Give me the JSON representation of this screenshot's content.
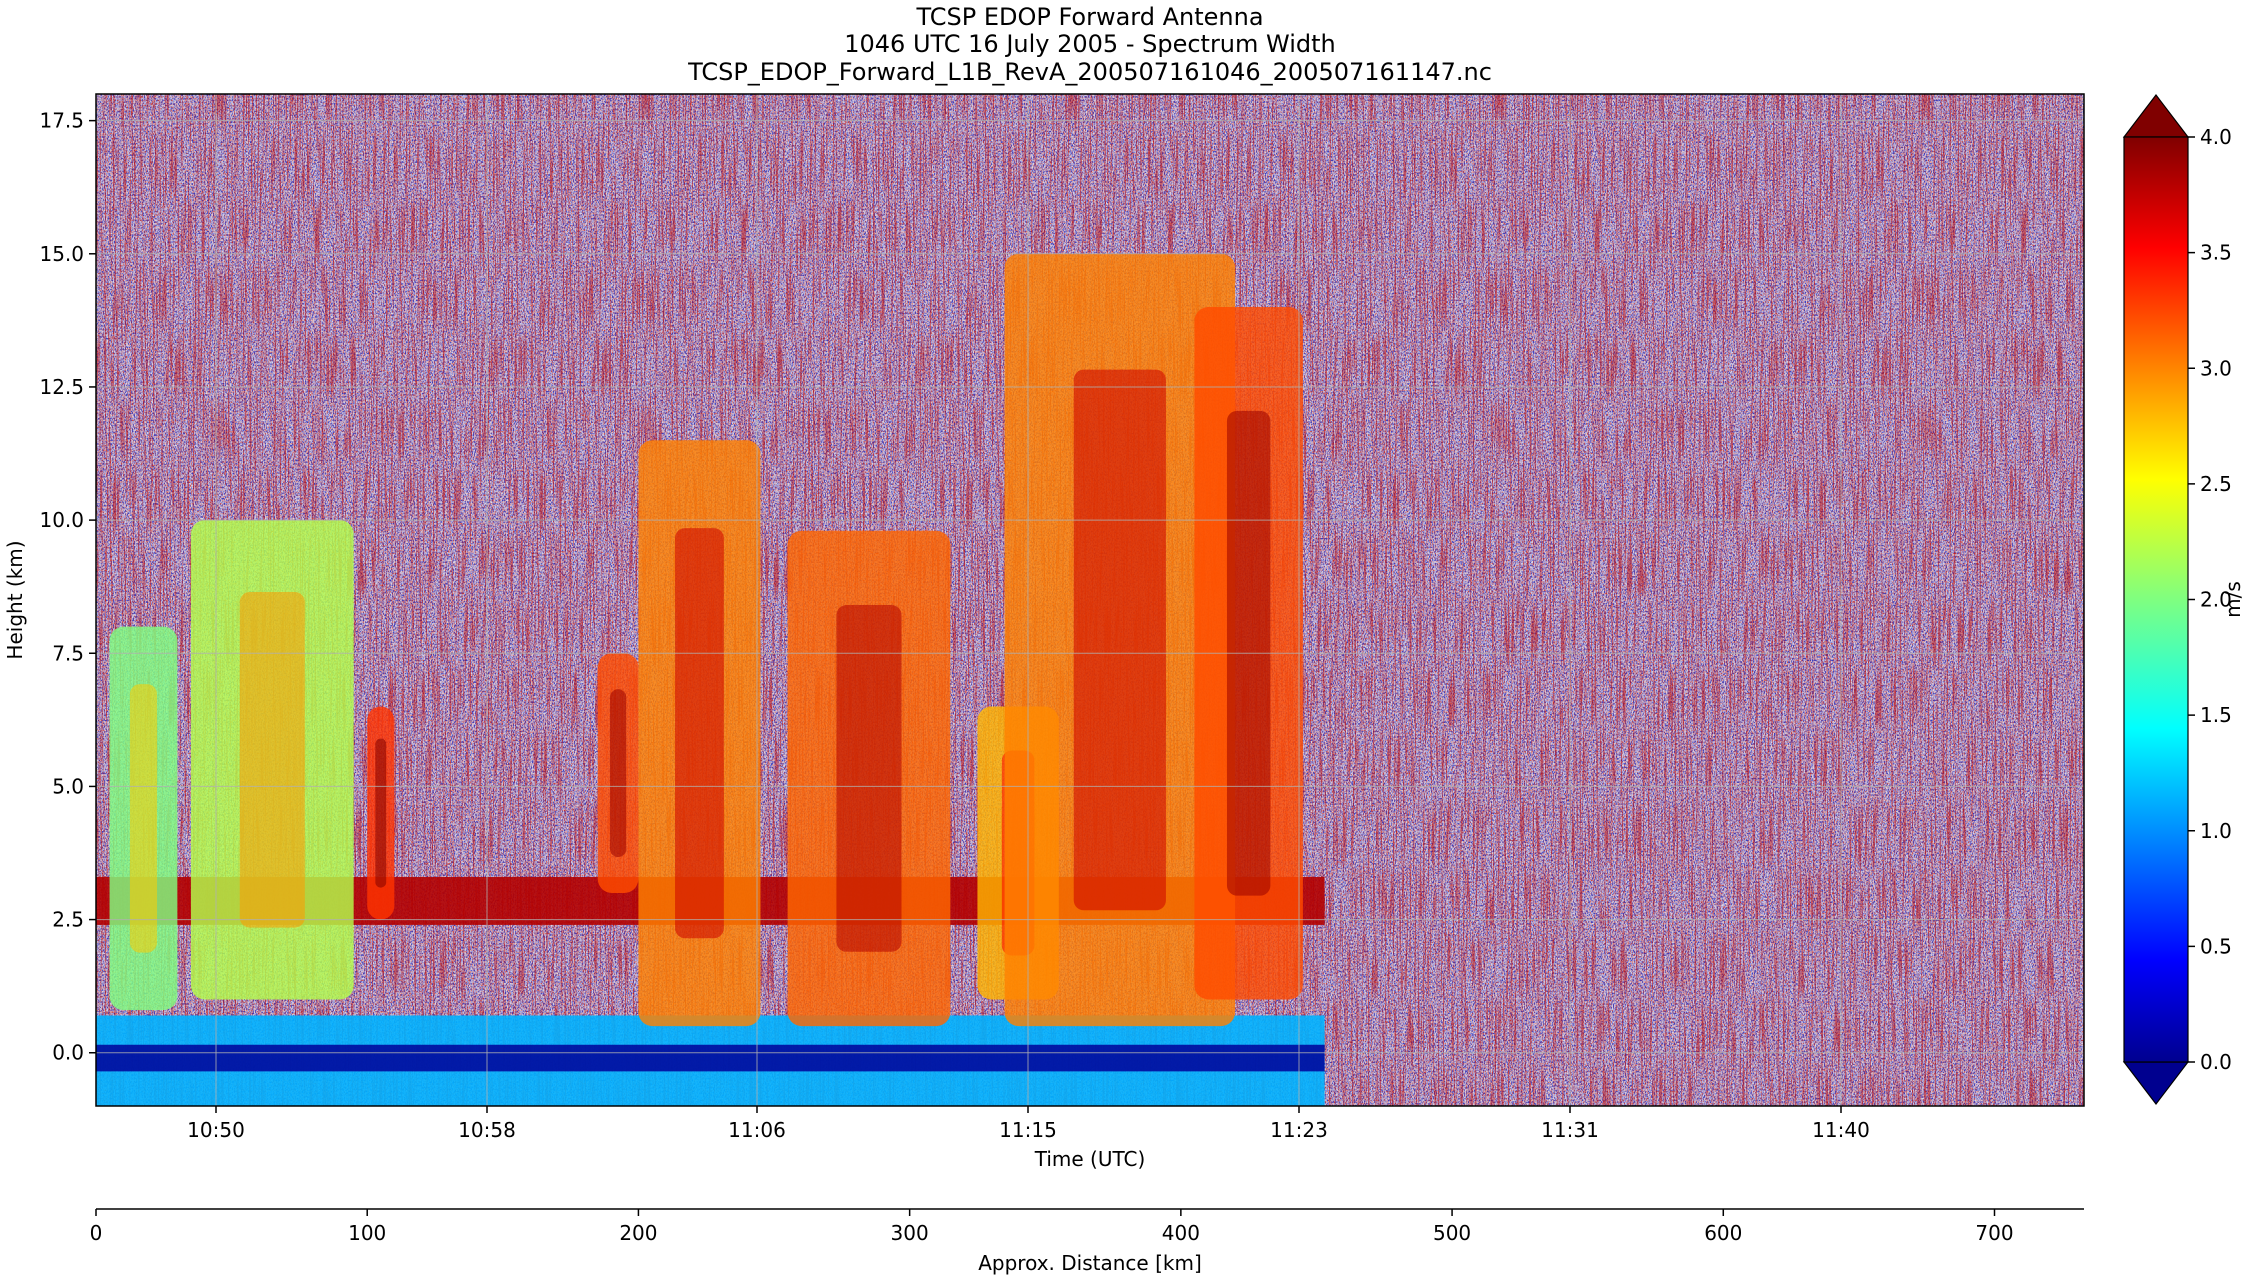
{
  "chart_data": {
    "type": "heatmap",
    "title": [
      "TCSP EDOP Forward Antenna",
      "1046 UTC 16 July 2005 - Spectrum Width",
      "TCSP_EDOP_Forward_L1B_RevA_200507161046_200507161147.nc"
    ],
    "xlabel": "Time (UTC)",
    "ylabel": "Height (km)",
    "x2label": "Approx. Distance [km]",
    "ylim": [
      -1.0,
      18.0
    ],
    "y_ticks": [
      0.0,
      2.5,
      5.0,
      7.5,
      10.0,
      12.5,
      15.0,
      17.5
    ],
    "y_tick_labels": [
      "0.0",
      "2.5",
      "5.0",
      "7.5",
      "10.0",
      "12.5",
      "15.0",
      "17.5"
    ],
    "x_tick_labels": [
      "10:50",
      "10:58",
      "11:06",
      "11:15",
      "11:23",
      "11:31",
      "11:40"
    ],
    "x2lim": [
      0,
      733
    ],
    "x2_ticks": [
      0,
      100,
      200,
      300,
      400,
      500,
      600,
      700
    ],
    "x2_tick_labels": [
      "0",
      "100",
      "200",
      "300",
      "400",
      "500",
      "600",
      "700"
    ],
    "colorbar": {
      "label": "m/s",
      "range": [
        0.0,
        4.0
      ],
      "ticks": [
        0.0,
        0.5,
        1.0,
        1.5,
        2.0,
        2.5,
        3.0,
        3.5,
        4.0
      ],
      "tick_labels": [
        "0.0",
        "0.5",
        "1.0",
        "1.5",
        "2.0",
        "2.5",
        "3.0",
        "3.5",
        "4.0"
      ],
      "colormap": "jet",
      "extend": "both"
    },
    "grid": true,
    "echo_end_km": 453,
    "features": [
      {
        "name": "surface-return",
        "y_range": [
          -1.0,
          0.7
        ],
        "value": 1.2
      },
      {
        "name": "melting-band",
        "y_range": [
          2.4,
          3.3
        ],
        "value": 3.8
      },
      {
        "name": "cell",
        "x_range": [
          5,
          30
        ],
        "y_range": [
          0.8,
          8.0
        ],
        "value": 2.0
      },
      {
        "name": "cell",
        "x_range": [
          35,
          95
        ],
        "y_range": [
          1.0,
          10.0
        ],
        "value": 2.2
      },
      {
        "name": "cell",
        "x_range": [
          100,
          110
        ],
        "y_range": [
          2.5,
          6.5
        ],
        "value": 3.3
      },
      {
        "name": "cell",
        "x_range": [
          185,
          200
        ],
        "y_range": [
          3.0,
          7.5
        ],
        "value": 3.2
      },
      {
        "name": "cell",
        "x_range": [
          200,
          245
        ],
        "y_range": [
          0.5,
          11.5
        ],
        "value": 3.0
      },
      {
        "name": "cell",
        "x_range": [
          255,
          315
        ],
        "y_range": [
          0.5,
          9.8
        ],
        "value": 3.1
      },
      {
        "name": "cell",
        "x_range": [
          325,
          355
        ],
        "y_range": [
          1.0,
          6.5
        ],
        "value": 2.8
      },
      {
        "name": "cell",
        "x_range": [
          335,
          420
        ],
        "y_range": [
          0.5,
          15.0
        ],
        "value": 3.0
      },
      {
        "name": "cell",
        "x_range": [
          405,
          445
        ],
        "y_range": [
          1.0,
          14.0
        ],
        "value": 3.2
      }
    ]
  }
}
